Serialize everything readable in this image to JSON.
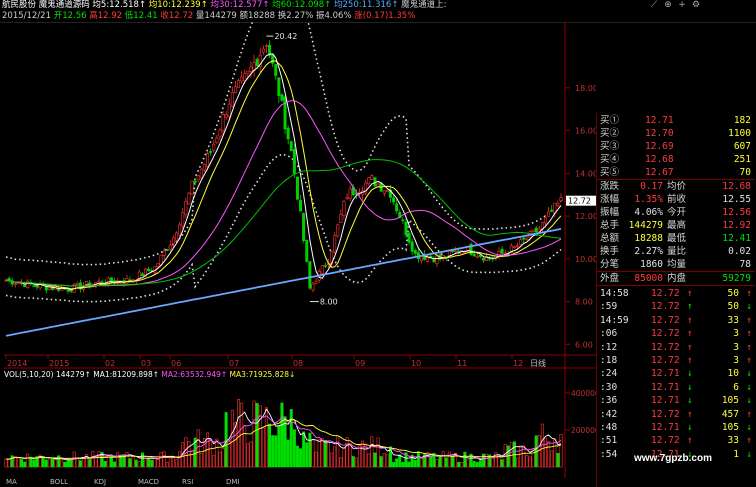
{
  "header": {
    "stock_name": "航民股份",
    "indicator_name": "魔鬼通道源码",
    "ma_values": [
      {
        "label": "均5:",
        "value": "12.518",
        "color": "#ffffff"
      },
      {
        "label": "均10:",
        "value": "12.239",
        "color": "#ffff3c"
      },
      {
        "label": "均30:",
        "value": "12.577",
        "color": "#ff55ff"
      },
      {
        "label": "均60:",
        "value": "12.098",
        "color": "#00e000"
      },
      {
        "label": "均250:",
        "value": "11.316",
        "color": "#55aaff"
      },
      {
        "label": "魔鬼通道上:",
        "value": "",
        "color": "#cccccc"
      }
    ],
    "row2": [
      {
        "label": "2015/12/21",
        "value": "",
        "color": "#cccccc"
      },
      {
        "label": "开",
        "value": "12.56",
        "color": "#00e000"
      },
      {
        "label": "高",
        "value": "12.92",
        "color": "#ff3b3b"
      },
      {
        "label": "低",
        "value": "12.41",
        "color": "#00e000"
      },
      {
        "label": "收",
        "value": "12.72",
        "color": "#ff3b3b"
      },
      {
        "label": "量",
        "value": "144279",
        "color": "#cccccc"
      },
      {
        "label": "额",
        "value": "18288",
        "color": "#cccccc"
      },
      {
        "label": "换",
        "value": "2.27%",
        "color": "#cccccc"
      },
      {
        "label": "振",
        "value": "4.06%",
        "color": "#cccccc"
      },
      {
        "label": "涨",
        "value": "(0.17)1.35%",
        "color": "#ff3b3b"
      }
    ]
  },
  "chart": {
    "price_ticks": [
      "18.00",
      "16.00",
      "14.00",
      "12.00",
      "10.00",
      "8.00",
      "6.00"
    ],
    "peak_label": "20.42",
    "low_label": "8.00",
    "current_price": "12.72",
    "x_labels": [
      "2014",
      "2015",
      "02",
      "03",
      "06",
      "07",
      "08",
      "09",
      "10",
      "11",
      "12"
    ],
    "daily_label": "日线",
    "volume_header": [
      {
        "text": "VOL(5,10,20)",
        "color": "#ffffff"
      },
      {
        "text": "144279↑",
        "color": "#ffffff"
      },
      {
        "text": "MA1:81209.898↑",
        "color": "#ffffff"
      },
      {
        "text": "MA2:63532.949↑",
        "color": "#ff55ff"
      },
      {
        "text": "MA3:71925.828↓",
        "color": "#ffff3c"
      }
    ],
    "volume_ticks": [
      "400000",
      "200000"
    ]
  },
  "order_book": {
    "bids": [
      {
        "label": "买①",
        "price": "12.71",
        "vol": "182"
      },
      {
        "label": "买②",
        "price": "12.70",
        "vol": "1100"
      },
      {
        "label": "买③",
        "price": "12.69",
        "vol": "607"
      },
      {
        "label": "买④",
        "price": "12.68",
        "vol": "251"
      },
      {
        "label": "买⑤",
        "price": "12.67",
        "vol": "70"
      }
    ],
    "stats": [
      {
        "l1": "涨跌",
        "v1": "0.17",
        "c1": "red",
        "l2": "均价",
        "v2": "12.68",
        "c2": "red"
      },
      {
        "l1": "涨幅",
        "v1": "1.35%",
        "c1": "red",
        "l2": "前收",
        "v2": "12.55",
        "c2": "white"
      },
      {
        "l1": "振幅",
        "v1": "4.06%",
        "c1": "white",
        "l2": "今开",
        "v2": "12.56",
        "c2": "red"
      },
      {
        "l1": "总手",
        "v1": "144279",
        "c1": "yellow",
        "l2": "最高",
        "v2": "12.92",
        "c2": "red"
      },
      {
        "l1": "总额",
        "v1": "18288",
        "c1": "yellow",
        "l2": "最低",
        "v2": "12.41",
        "c2": "green"
      },
      {
        "l1": "换手",
        "v1": "2.27%",
        "c1": "white",
        "l2": "量比",
        "v2": "0.02",
        "c2": "white"
      },
      {
        "l1": "分笔",
        "v1": "1860",
        "c1": "white",
        "l2": "均量",
        "v2": "78",
        "c2": "white"
      }
    ],
    "outer": {
      "l1": "外盘",
      "v1": "85000",
      "l2": "内盘",
      "v2": "59279"
    },
    "ticks": [
      {
        "time": "14:58",
        "price": "12.72",
        "arrow": "↑",
        "vol": "50",
        "dir": "up"
      },
      {
        "time": ":59",
        "price": "12.72",
        "arrow": "↑",
        "vol": "50",
        "dir": "down"
      },
      {
        "time": "14:59",
        "price": "12.72",
        "arrow": "↑",
        "vol": "33",
        "dir": "up"
      },
      {
        "time": ":06",
        "price": "12.72",
        "arrow": "↑",
        "vol": "3",
        "dir": "up"
      },
      {
        "time": ":12",
        "price": "12.72",
        "arrow": "↑",
        "vol": "3",
        "dir": "up"
      },
      {
        "time": ":18",
        "price": "12.72",
        "arrow": "↑",
        "vol": "3",
        "dir": "up"
      },
      {
        "time": ":24",
        "price": "12.71",
        "arrow": "↓",
        "vol": "10",
        "dir": "down"
      },
      {
        "time": ":30",
        "price": "12.71",
        "arrow": "↓",
        "vol": "6",
        "dir": "down"
      },
      {
        "time": ":36",
        "price": "12.71",
        "arrow": "↓",
        "vol": "105",
        "dir": "down"
      },
      {
        "time": ":42",
        "price": "12.72",
        "arrow": "↑",
        "vol": "457",
        "dir": "up"
      },
      {
        "time": ":48",
        "price": "12.71",
        "arrow": "↓",
        "vol": "105",
        "dir": "down"
      },
      {
        "time": ":51",
        "price": "12.72",
        "arrow": "↑",
        "vol": "33",
        "dir": "up"
      },
      {
        "time": ":54",
        "price": "12.71",
        "arrow": "↓",
        "vol": "1",
        "dir": "down"
      }
    ]
  },
  "bottom_tabs": [
    "MA",
    "BOLL",
    "KDJ",
    "MACD",
    "RSI",
    "DMI"
  ],
  "watermark": "www.7gpzb.com"
}
